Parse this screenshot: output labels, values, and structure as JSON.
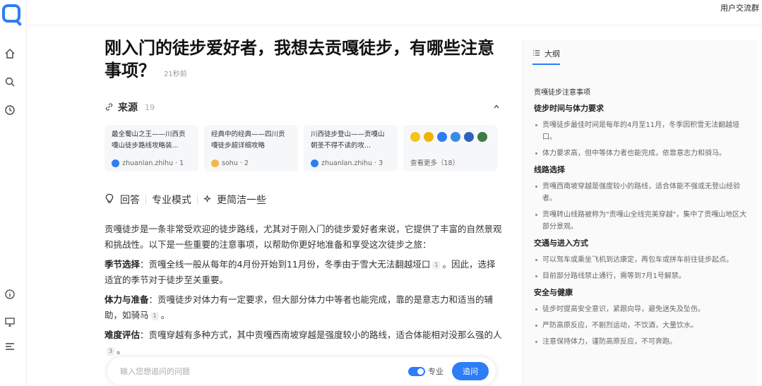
{
  "topbar": {
    "user_group": "用户交流群"
  },
  "question": {
    "title": "刚入门的徒步爱好者，我想去贡嘎徒步，有哪些注意事项？",
    "time": "21秒前"
  },
  "sources": {
    "label": "来源",
    "count": "19",
    "cards": [
      {
        "title": "最全蜀山之王——川西贡嘎山徒步路线攻略装...",
        "site": "zhuanlan.zhihu · 1"
      },
      {
        "title": "经典中的经典——四川贡嘎徒步超详细攻略",
        "site": "sohu · 2"
      },
      {
        "title": "川西徒步登山——贡嘎山朝圣不得不读的攻...",
        "site": "zhuanlan.zhihu · 3"
      }
    ],
    "more": "查看更多（18）"
  },
  "answer_tabs": {
    "answer": "回答",
    "pro_mode": "专业模式",
    "simpler": "更简洁一些"
  },
  "answer": {
    "intro": "贡嘎徒步是一条非常受欢迎的徒步路线，尤其对于刚入门的徒步爱好者来说，它提供了丰富的自然景观和挑战性。以下是一些重要的注意事项，以帮助你更好地准备和享受这次徒步之旅：",
    "p1_label": "季节选择",
    "p1_text": "：贡嘎全线一般从每年的4月份开始到11月份，冬季由于雪大无法翻越垭口",
    "p1_ref": "1",
    "p1_tail": "。因此，选择适宜的季节对于徒步至关重要。",
    "p2_label": "体力与准备",
    "p2_text": "：贡嘎徒步对体力有一定要求，但大部分体力中等者也能完成，靠的是意志力和适当的辅助，如骑马",
    "p2_ref": "1",
    "p2_tail": "。",
    "p3_label": "难度评估",
    "p3_text": "：贡嘎穿越有多种方式，其中贡嘎西南坡穿越是强度较小的路线，适合体能相对没那么强的人",
    "p3_ref": "3",
    "p3_tail": "。"
  },
  "ask": {
    "placeholder": "输入您想追问的问题",
    "pro_label": "专业",
    "button": "追问"
  },
  "outline": {
    "tab": "大纲",
    "main_title": "贡嘎徒步注意事项",
    "sections": [
      {
        "heading": "徒步时间与体力要求",
        "items": [
          "贡嘎徒步最佳时间是每年的4月至11月，冬季因积雪无法翻越垭口。",
          "体力要求高，但中等体力者也能完成，依靠意志力和骑马。"
        ]
      },
      {
        "heading": "线路选择",
        "items": [
          "贡嘎西南坡穿越是强度较小的路线，适合体能不强或无登山经验者。",
          "贡嘎转山线路被称为\"贡嘎山全线完美穿越\"，集中了贡嘎山地区大部分景观。"
        ]
      },
      {
        "heading": "交通与进入方式",
        "items": [
          "可以驾车或乘坐飞机到达康定，再包车或拼车前往徒步起点。",
          "目前部分路线禁止通行，需等到7月1号解禁。"
        ]
      },
      {
        "heading": "安全与健康",
        "items": [
          "徒步时提高安全意识，紧跟向导，避免迷失及坠伤。",
          "严防高原反应，不剧烈运动，不饮酒，大量饮水。",
          "注意保持体力，谨防高原反应，不可奔跑。"
        ]
      }
    ]
  },
  "colors": {
    "accent": "#2d7df6"
  }
}
